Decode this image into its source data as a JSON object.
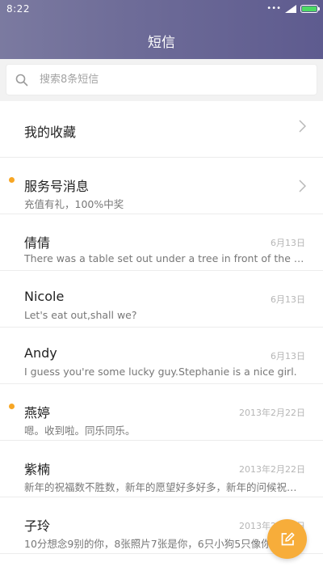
{
  "status_bar": {
    "time": "8:22",
    "dots": "•••"
  },
  "header": {
    "title": "短信"
  },
  "search": {
    "placeholder": "搜索8条短信"
  },
  "list": {
    "favorites": {
      "title": "我的收藏"
    },
    "items": [
      {
        "name": "服务号消息",
        "preview": "充值有礼，100%中奖",
        "date": "",
        "unread": true,
        "chevron": true
      },
      {
        "name": "倩倩",
        "preview": "There was a table set out under a tree in front of the house",
        "date": "6月13日",
        "unread": false
      },
      {
        "name": "Nicole",
        "preview": "Let's eat out,shall we?",
        "date": "6月13日",
        "unread": false
      },
      {
        "name": "Andy",
        "preview": "I guess you're some lucky guy.Stephanie is a nice girl.",
        "date": "6月13日",
        "unread": false
      },
      {
        "name": "燕婷",
        "preview": "嗯。收到啦。同乐同乐。",
        "date": "2013年2月22日",
        "unread": true
      },
      {
        "name": "紫楠",
        "preview": "新年的祝福数不胜数，新年的愿望好多好多，新年的问候祝你快乐",
        "date": "2013年2月22日",
        "unread": false
      },
      {
        "name": "子玲",
        "preview": "10分想念9别的你，8张照片7张是你，6只小狗5只像你",
        "date": "2013年2月22日",
        "unread": false
      }
    ]
  },
  "colors": {
    "header_start": "#7b7aa0",
    "header_end": "#5e5b8f",
    "accent": "#f7ad3a",
    "unread_dot": "#f7a624",
    "battery": "#4cd964"
  },
  "icons": {
    "search": "search-icon",
    "chevron": "chevron-right-icon",
    "compose": "compose-icon"
  }
}
